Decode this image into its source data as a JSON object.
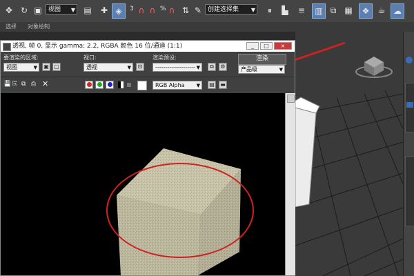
{
  "toolbar": {
    "select_value": "视图",
    "snap_angle": "3",
    "percent": "%",
    "selection_set": "创建选择集",
    "icons": [
      "move-icon",
      "rotate-icon",
      "scale-icon",
      "select-filter-icon",
      "mirror-icon",
      "align-icon",
      "layer-icon",
      "curve-editor-icon",
      "schematic-icon",
      "material-editor-icon",
      "render-setup-icon",
      "render-frame-icon",
      "render-icon"
    ]
  },
  "ribbon": {
    "label_1": "选择",
    "label_2": "对象绘制"
  },
  "render_frame": {
    "title": "透视, 帧 0, 显示 gamma: 2.2, RGBA 颜色 16 位/通道 (1:1)",
    "area_label": "要渲染的区域:",
    "area_value": "视图",
    "viewport_label": "视口:",
    "viewport_value": "透视",
    "preset_label": "渲染预设:",
    "preset_value": "--------------------",
    "render_button": "渲染",
    "quality_value": "产品级",
    "channel_value": "RGB Alpha",
    "window_buttons": [
      "_",
      "□",
      "×"
    ]
  },
  "colors": {
    "accent": "#5a7fb0",
    "annotation": "#cc2222",
    "cube": "#c8c3a8"
  }
}
